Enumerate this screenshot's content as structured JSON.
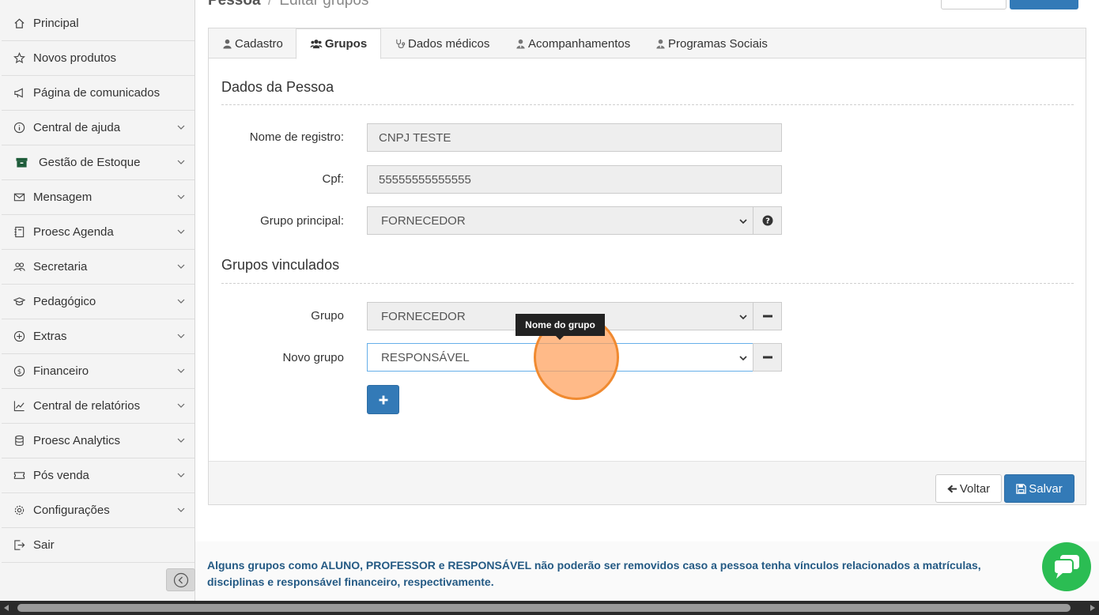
{
  "header": {
    "title": "Pessoa",
    "separator": "/",
    "subtitle": "Editar grupos"
  },
  "sidebar": {
    "items": [
      {
        "label": "Principal",
        "icon": "home-icon",
        "expandable": false
      },
      {
        "label": "Novos produtos",
        "icon": "star-icon",
        "expandable": false
      },
      {
        "label": "Página de comunicados",
        "icon": "megaphone-icon",
        "expandable": false
      },
      {
        "label": "Central de ajuda",
        "icon": "info-icon",
        "expandable": true
      },
      {
        "label": "Gestão de Estoque",
        "icon": "archive-box-icon",
        "expandable": true
      },
      {
        "label": "Mensagem",
        "icon": "envelope-icon",
        "expandable": true
      },
      {
        "label": "Proesc Agenda",
        "icon": "notebook-icon",
        "expandable": true
      },
      {
        "label": "Secretaria",
        "icon": "users-icon",
        "expandable": true
      },
      {
        "label": "Pedagógico",
        "icon": "graduation-cap-icon",
        "expandable": true
      },
      {
        "label": "Extras",
        "icon": "plus-circle-icon",
        "expandable": true
      },
      {
        "label": "Financeiro",
        "icon": "dollar-circle-icon",
        "expandable": true
      },
      {
        "label": "Central de relatórios",
        "icon": "line-chart-icon",
        "expandable": true
      },
      {
        "label": "Proesc Analytics",
        "icon": "database-icon",
        "expandable": true
      },
      {
        "label": "Pós venda",
        "icon": "ticket-icon",
        "expandable": true
      },
      {
        "label": "Configurações",
        "icon": "gear-icon",
        "expandable": true
      },
      {
        "label": "Sair",
        "icon": "logout-icon",
        "expandable": false
      }
    ]
  },
  "tabs": [
    {
      "label": "Cadastro",
      "icon": "user-icon",
      "active": false
    },
    {
      "label": "Grupos",
      "icon": "users-icon",
      "active": true
    },
    {
      "label": "Dados médicos",
      "icon": "stethoscope-icon",
      "active": false
    },
    {
      "label": "Acompanhamentos",
      "icon": "user-tie-icon",
      "active": false
    },
    {
      "label": "Programas Sociais",
      "icon": "user-tie-icon",
      "active": false
    }
  ],
  "dados_pessoa": {
    "title": "Dados da Pessoa",
    "nome_label": "Nome de registro:",
    "nome_value": "CNPJ TESTE",
    "cpf_label": "Cpf:",
    "cpf_value": "55555555555555",
    "grupo_principal_label": "Grupo principal:",
    "grupo_principal_value": "FORNECEDOR"
  },
  "grupos_vinculados": {
    "title": "Grupos vinculados",
    "grupo_label": "Grupo",
    "grupo_value": "FORNECEDOR",
    "novo_grupo_label": "Novo grupo",
    "novo_grupo_value": "RESPONSÁVEL",
    "tooltip": "Nome do grupo"
  },
  "footer": {
    "voltar_label": "Voltar",
    "salvar_label": "Salvar"
  },
  "notice": {
    "text": "Alguns grupos como ALUNO, PROFESSOR e RESPONSÁVEL não poderão ser removidos caso a pessoa tenha vínculos relacionados a matrículas, disciplinas e responsável financeiro, respectivamente."
  },
  "colors": {
    "primary": "#337ab7",
    "notice_text": "#245a84",
    "chat": "#2bbd53",
    "highlight": "#f08a30"
  }
}
